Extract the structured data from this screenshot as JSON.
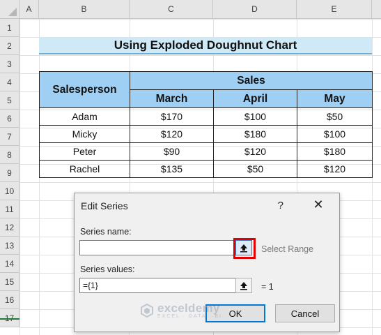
{
  "columns": [
    "A",
    "B",
    "C",
    "D",
    "E"
  ],
  "rows": [
    "1",
    "2",
    "3",
    "4",
    "5",
    "6",
    "7",
    "8",
    "9",
    "10",
    "11",
    "12",
    "13",
    "14",
    "15",
    "16",
    "17"
  ],
  "title": "Using Exploded Doughnut Chart",
  "table": {
    "header_person": "Salesperson",
    "header_sales": "Sales",
    "months": [
      "March",
      "April",
      "May"
    ],
    "data": [
      {
        "name": "Adam",
        "values": [
          "$170",
          "$100",
          "$50"
        ]
      },
      {
        "name": "Micky",
        "values": [
          "$120",
          "$180",
          "$100"
        ]
      },
      {
        "name": "Peter",
        "values": [
          "$90",
          "$120",
          "$180"
        ]
      },
      {
        "name": "Rachel",
        "values": [
          "$135",
          "$50",
          "$120"
        ]
      }
    ]
  },
  "dialog": {
    "title": "Edit Series",
    "help": "?",
    "close": "✕",
    "series_name_label": "Series name:",
    "series_name_value": "",
    "select_range": "Select Range",
    "series_values_label": "Series values:",
    "series_values_value": "={1}",
    "series_values_result": "= 1",
    "ok": "OK",
    "cancel": "Cancel"
  },
  "watermark": {
    "name": "exceldemy",
    "sub": "EXCEL · DATA · BI"
  },
  "icons": {
    "range_select": "collapse-dialog-icon",
    "watermark": "exceldemy-logo-icon"
  },
  "colors": {
    "title_fill": "#cfe9f7",
    "header_fill": "#9fd0f4",
    "highlight": "#e00000"
  }
}
